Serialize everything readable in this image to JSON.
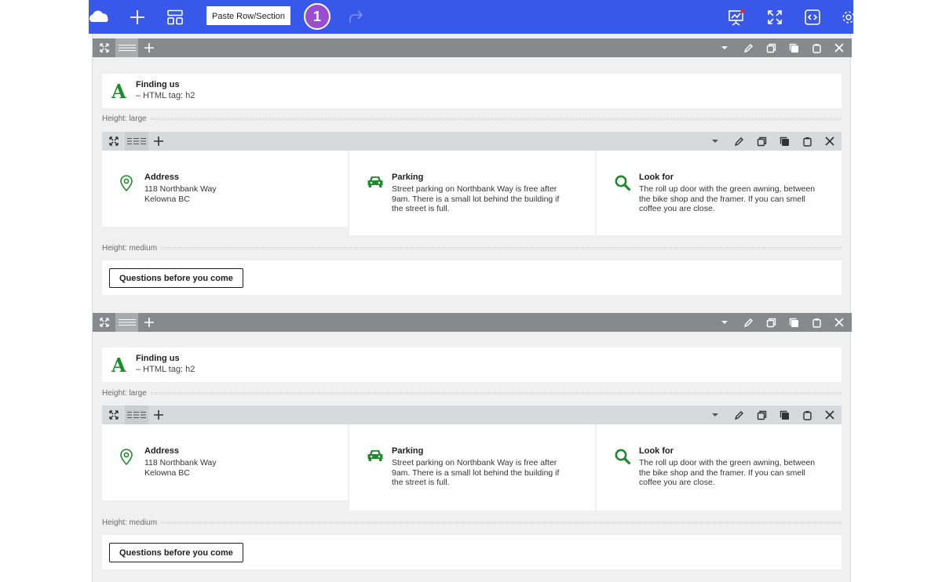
{
  "toolbar": {
    "paste_label": "Paste Row/Section",
    "step_number": "1",
    "icons": [
      "cloud-icon",
      "plus-icon",
      "layout-icon",
      "redo-icon",
      "presentation-icon",
      "expand-icon",
      "code-icon",
      "gear-icon"
    ],
    "background": "#3858e9",
    "badge_color": "#9b4dd0"
  },
  "sections": [
    {
      "heading": {
        "letter": "A",
        "title": "Finding us",
        "subtitle": "– HTML tag: h2"
      },
      "spacer_large": "Height: large",
      "columns": [
        {
          "icon": "map-pin-icon",
          "title": "Address",
          "lines": [
            "118 Northbank Way",
            "Kelowna BC"
          ]
        },
        {
          "icon": "car-icon",
          "title": "Parking",
          "lines": [
            "Street parking on Northbank Way is free after",
            "9am. There is a small lot behind the building if",
            "the street is full."
          ]
        },
        {
          "icon": "search-icon",
          "title": "Look for",
          "lines": [
            "The roll up door with the green awning, between",
            "the bike shop and the framer. If you can smell",
            "coffee you are close."
          ]
        }
      ],
      "spacer_medium": "Height: medium",
      "button_label": "Questions before you come"
    },
    {
      "heading": {
        "letter": "A",
        "title": "Finding us",
        "subtitle": "– HTML tag: h2"
      },
      "spacer_large": "Height: large",
      "columns": [
        {
          "icon": "map-pin-icon",
          "title": "Address",
          "lines": [
            "118 Northbank Way",
            "Kelowna BC"
          ]
        },
        {
          "icon": "car-icon",
          "title": "Parking",
          "lines": [
            "Street parking on Northbank Way is free after",
            "9am. There is a small lot behind the building if",
            "the street is full."
          ]
        },
        {
          "icon": "search-icon",
          "title": "Look for",
          "lines": [
            "The roll up door with the green awning, between",
            "the bike shop and the framer. If you can smell",
            "coffee you are close."
          ]
        }
      ],
      "spacer_medium": "Height: medium",
      "button_label": "Questions before you come"
    }
  ],
  "colors": {
    "accent_green": "#1d8a2c",
    "section_bar": "#87898c",
    "row_bar": "#d8d9da"
  }
}
